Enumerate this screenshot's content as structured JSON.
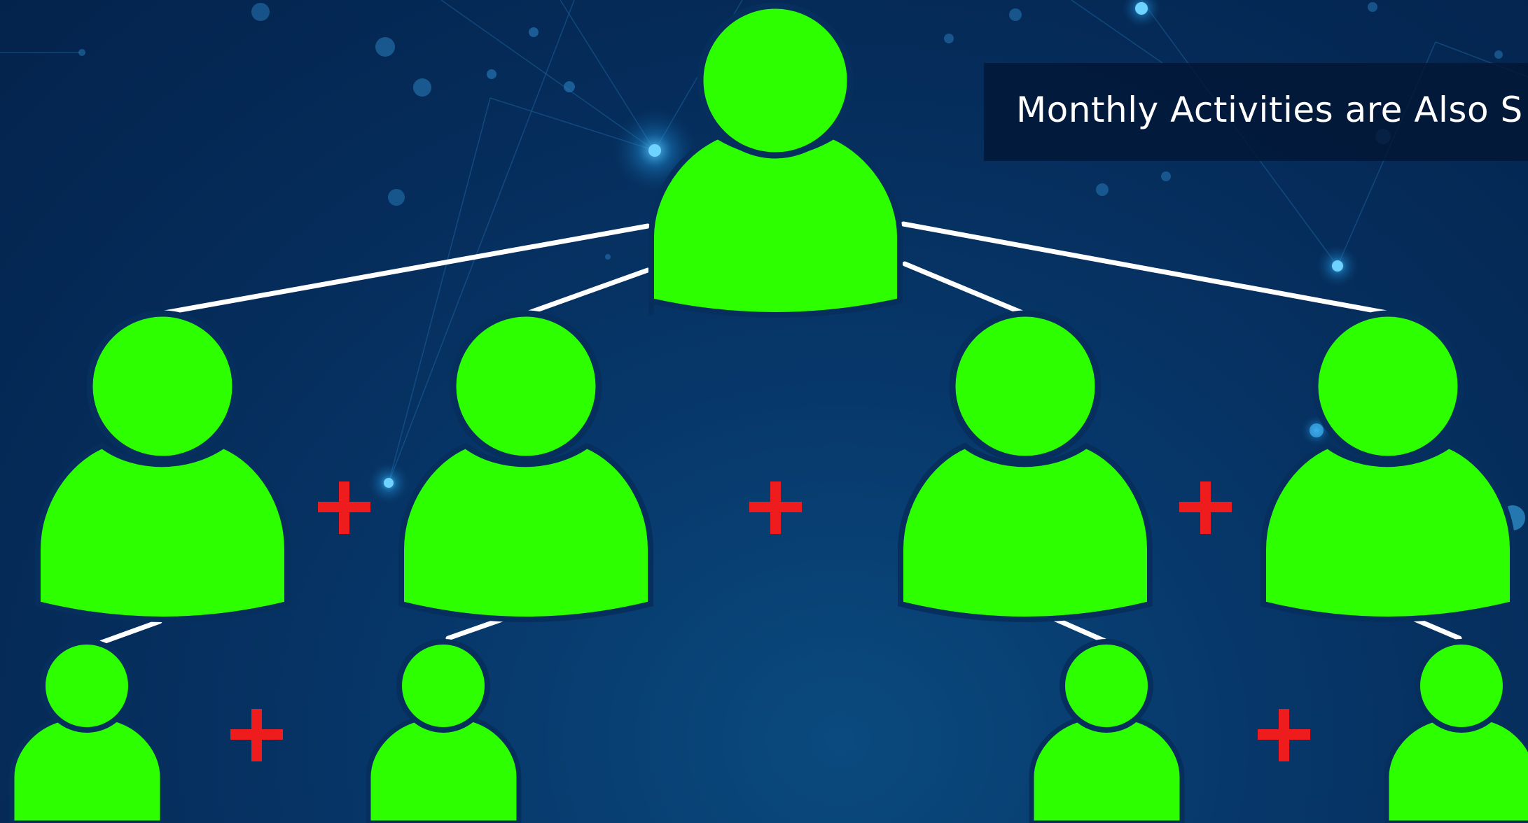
{
  "caption": {
    "text": "Monthly Activities are Also S"
  },
  "colors": {
    "person": "#2dff00",
    "outline": "#062f5e",
    "connector": "#ffffff",
    "plus": "#ee1c1c"
  },
  "icons": {
    "person": "person-icon",
    "plus": "plus-icon"
  },
  "diagram": {
    "top_level": 1,
    "second_level": 4,
    "third_level": 4,
    "plus_count": 5
  }
}
